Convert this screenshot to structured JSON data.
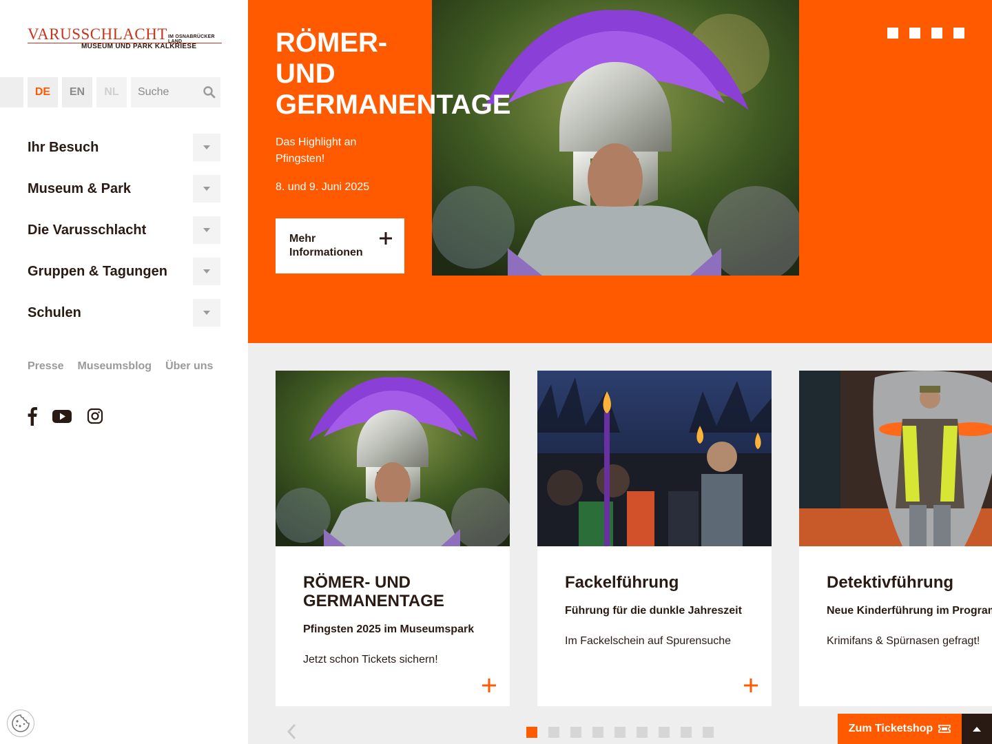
{
  "logo": {
    "main": "VARUSSCHLACHT",
    "region": "IM OSNABRÜCKER LAND",
    "sub": "MUSEUM UND PARK KALKRIESE"
  },
  "languages": [
    "DE",
    "EN",
    "NL"
  ],
  "active_language": "DE",
  "search": {
    "placeholder": "Suche"
  },
  "nav": {
    "items": [
      {
        "label": "Ihr Besuch"
      },
      {
        "label": "Museum & Park"
      },
      {
        "label": "Die Varusschlacht"
      },
      {
        "label": "Gruppen & Tagungen"
      },
      {
        "label": "Schulen"
      }
    ]
  },
  "meta_links": [
    "Presse",
    "Museumsblog",
    "Über uns"
  ],
  "social": [
    "facebook-icon",
    "youtube-icon",
    "instagram-icon"
  ],
  "hero": {
    "title_line1": "RÖMER-",
    "title_line2": "UND",
    "title_line3": "GERMANENTAGE",
    "text": "Das Highlight an Pfingsten!",
    "date": "8. und 9. Juni 2025",
    "button": "Mehr Informationen",
    "slide_count": 4
  },
  "cards": [
    {
      "title": "RÖMER- UND GERMANENTAGE",
      "subtitle": "Pfingsten 2025 im Museumspark",
      "description": "Jetzt schon Tickets sichern!"
    },
    {
      "title": "Fackelführung",
      "subtitle": "Führung für die dunkle Jahreszeit",
      "description": "Im Fackelschein auf Spurensuche"
    },
    {
      "title": "Detektivführung",
      "subtitle": "Neue Kinderführung im Programm",
      "description": "Krimifans & Spürnasen gefragt!"
    }
  ],
  "slider": {
    "count": 9,
    "active": 1
  },
  "ticket_button": "Zum Ticketshop",
  "colors": {
    "accent": "#ff5a00",
    "text": "#2a1a14",
    "muted": "#9a9a9a",
    "panel": "#eeeeee"
  }
}
